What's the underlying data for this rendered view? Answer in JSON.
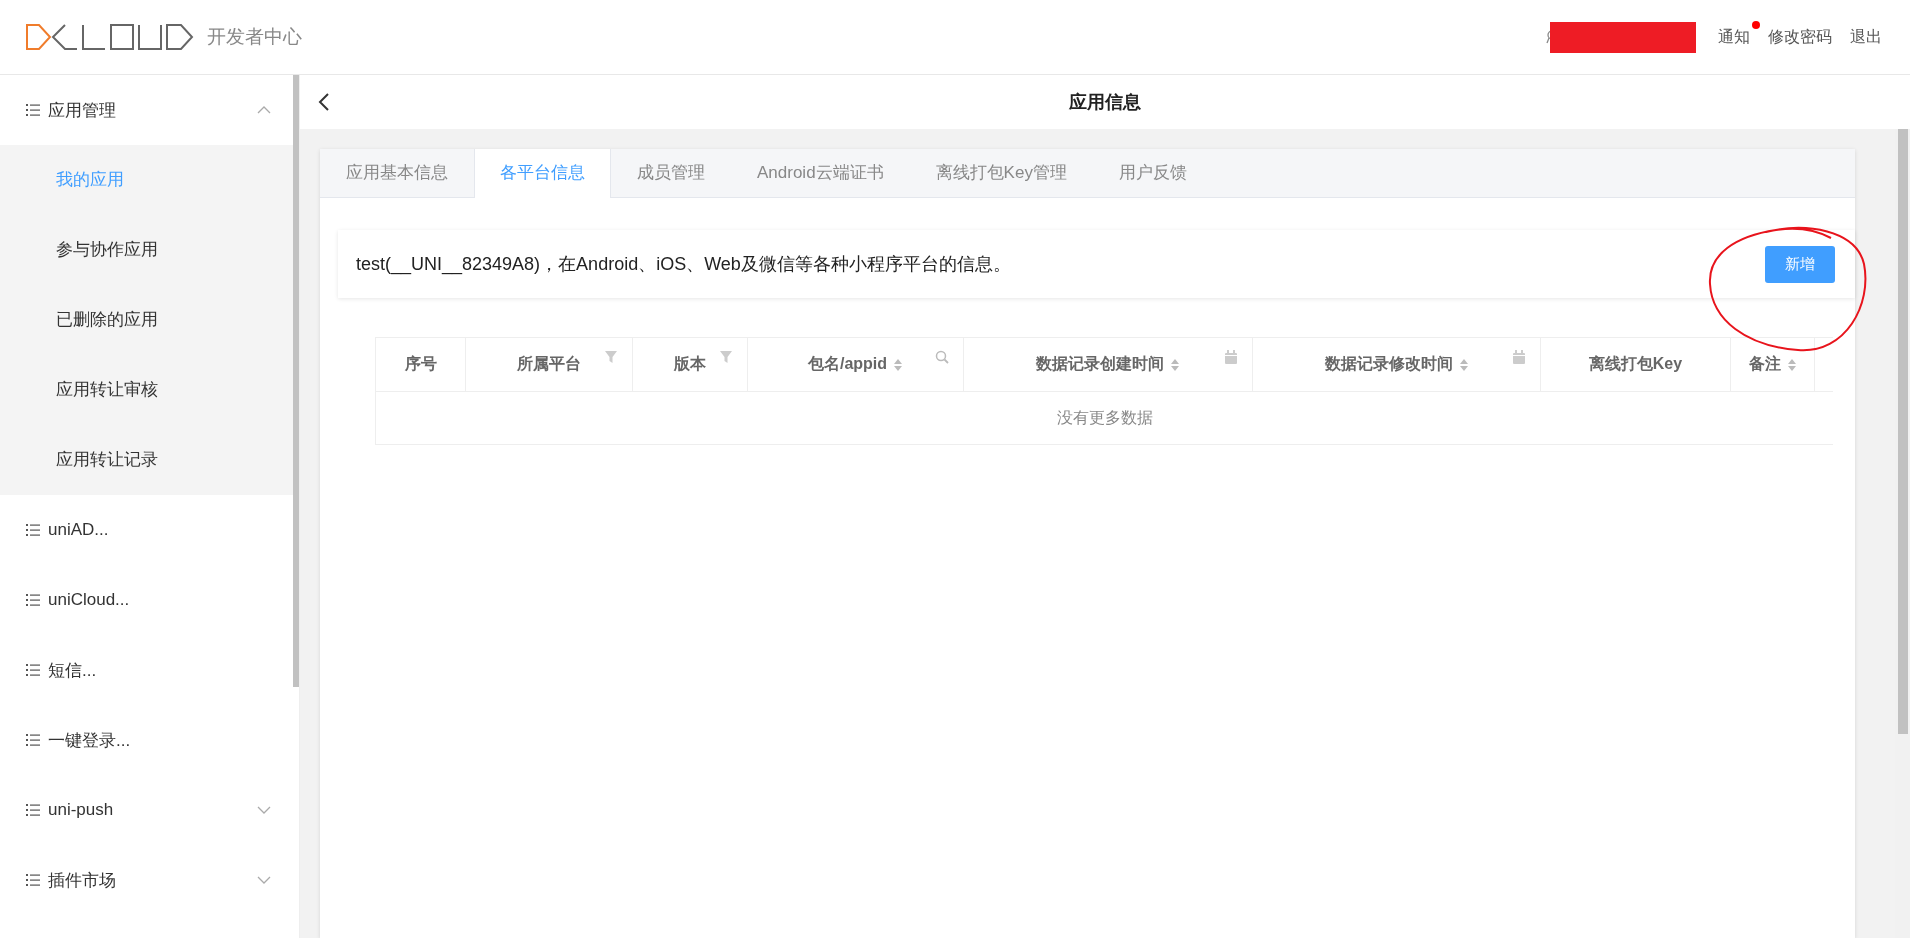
{
  "header": {
    "subtitle": "开发者中心",
    "links": [
      {
        "label": "通知",
        "unread": true
      },
      {
        "label": "修改密码",
        "unread": false
      },
      {
        "label": "退出",
        "unread": false
      }
    ]
  },
  "sidebar": {
    "items": [
      {
        "label": "应用管理",
        "kind": "group",
        "expanded": true,
        "children": [
          {
            "label": "我的应用",
            "selected": true
          },
          {
            "label": "参与协作应用",
            "selected": false
          },
          {
            "label": "已删除的应用",
            "selected": false
          },
          {
            "label": "应用转让审核",
            "selected": false
          },
          {
            "label": "应用转让记录",
            "selected": false
          }
        ]
      },
      {
        "label": "uniAD...",
        "kind": "item"
      },
      {
        "label": "uniCloud...",
        "kind": "item"
      },
      {
        "label": "短信...",
        "kind": "item"
      },
      {
        "label": "一键登录...",
        "kind": "item"
      },
      {
        "label": "uni-push",
        "kind": "group",
        "expanded": false
      },
      {
        "label": "插件市场",
        "kind": "group",
        "expanded": false
      }
    ]
  },
  "page_title": "应用信息",
  "tabs": [
    {
      "label": "应用基本信息",
      "selected": false
    },
    {
      "label": "各平台信息",
      "selected": true
    },
    {
      "label": "成员管理",
      "selected": false
    },
    {
      "label": "Android云端证书",
      "selected": false
    },
    {
      "label": "离线打包Key管理",
      "selected": false
    },
    {
      "label": "用户反馈",
      "selected": false
    }
  ],
  "description": "test(__UNI__82349A8)，在Android、iOS、Web及微信等各种小程序平台的信息。",
  "add_button": "新增",
  "table": {
    "columns": [
      {
        "label": "序号",
        "kind": "plain",
        "sort": false
      },
      {
        "label": "所属平台",
        "kind": "filter",
        "sort": false
      },
      {
        "label": "版本",
        "kind": "filter",
        "sort": false
      },
      {
        "label": "包名/appid",
        "kind": "search",
        "sort": true
      },
      {
        "label": "数据记录创建时间",
        "kind": "calendar",
        "sort": true
      },
      {
        "label": "数据记录修改时间",
        "kind": "calendar",
        "sort": true
      },
      {
        "label": "离线打包Key",
        "kind": "plain",
        "sort": false
      },
      {
        "label": "备注",
        "kind": "plain",
        "sort": true
      }
    ],
    "empty_text": "没有更多数据"
  }
}
